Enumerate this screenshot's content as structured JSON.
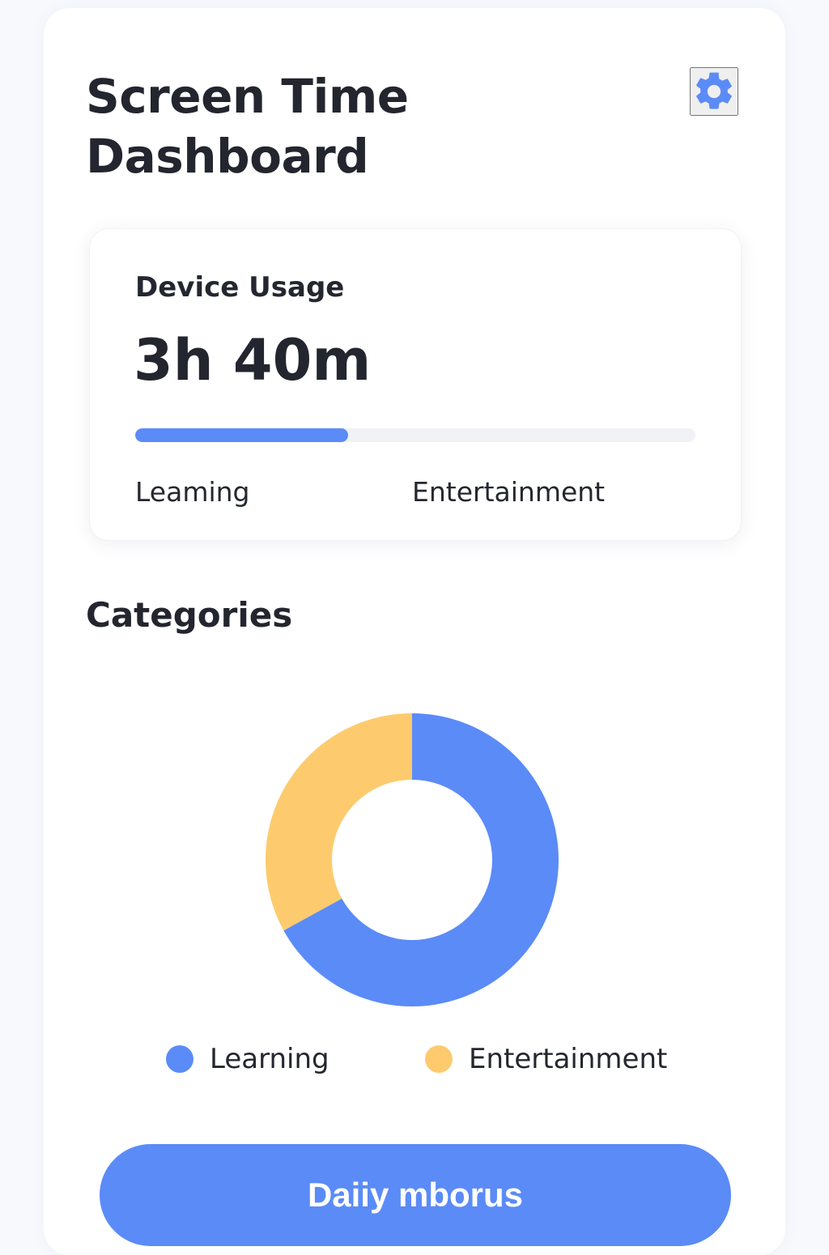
{
  "header": {
    "title": "Screen Time Dashboard",
    "settings_icon": "gear-icon"
  },
  "usage_card": {
    "title": "Device Usage",
    "total": "3h 40m",
    "progress_fraction": 0.38,
    "labels": [
      "Leaming",
      "Entertainment"
    ]
  },
  "categories": {
    "title": "Categories"
  },
  "chart_data": {
    "type": "pie",
    "title": "Categories",
    "slices": [
      {
        "label": "Learning",
        "value": 67,
        "color": "#5b8bf7"
      },
      {
        "label": "Entertainment",
        "value": 33,
        "color": "#fdcb6e"
      }
    ],
    "legend": "bottom"
  },
  "legend": [
    {
      "label": "Learning",
      "color": "#5b8bf7"
    },
    {
      "label": "Entertainment",
      "color": "#fdcb6e"
    }
  ],
  "primary_button": {
    "label": "Daiiy mborus"
  },
  "colors": {
    "accent": "#5b8bf7",
    "entertainment": "#fdcb6e",
    "track": "#f1f2f5",
    "text": "#23262e"
  }
}
